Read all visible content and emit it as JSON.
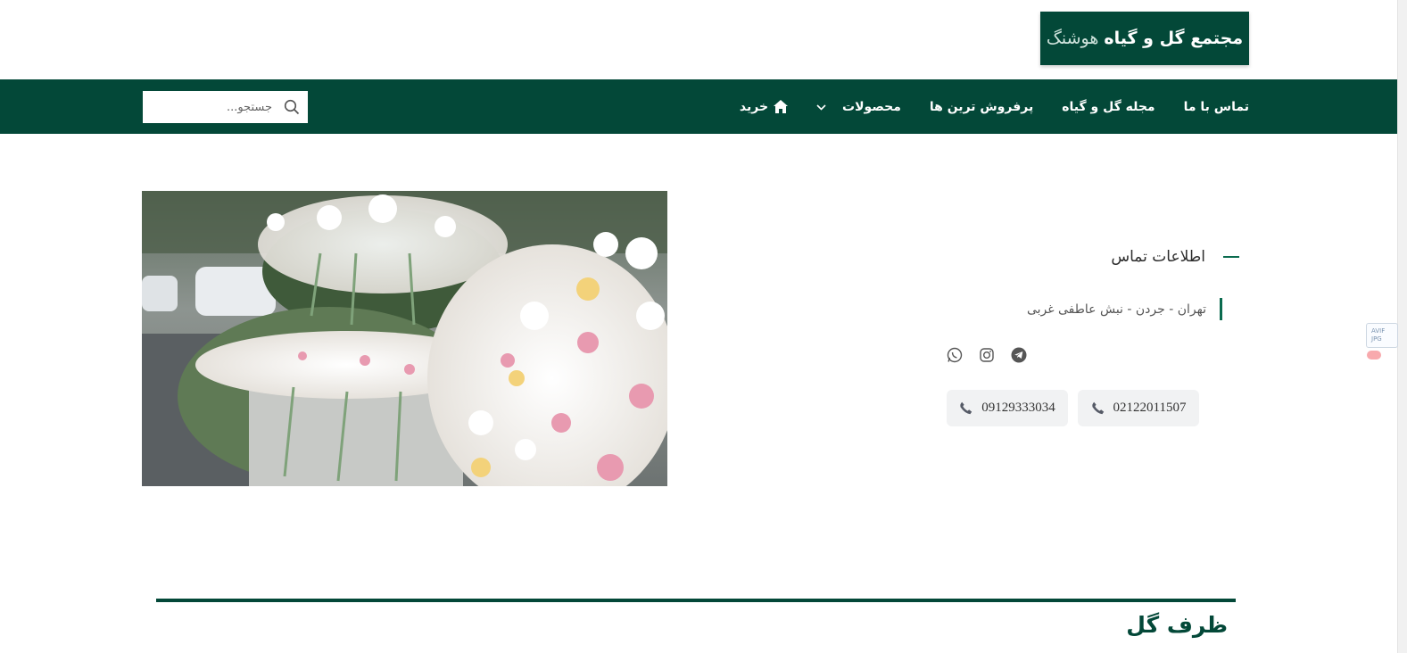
{
  "header": {
    "logo_bold": "مجتمع گل و گیاه",
    "logo_light": "هوشنگ"
  },
  "nav": {
    "items": [
      {
        "label": "خرید",
        "icon": "home-icon"
      },
      {
        "label": "محصولات",
        "icon": "chevron-down-icon"
      },
      {
        "label": "پرفروش ترین ها"
      },
      {
        "label": "مجله گل و گیاه"
      },
      {
        "label": "تماس با ما"
      }
    ],
    "search_placeholder": "جستجو..."
  },
  "contact": {
    "title": "اطلاعات تماس",
    "address": "تهران - جردن - نبش عاطفی غربی",
    "socials": [
      "whatsapp-icon",
      "instagram-icon",
      "telegram-icon"
    ],
    "phones": [
      "02122011507",
      "09129333034"
    ]
  },
  "section": {
    "title": "ظرف گل"
  },
  "extension_badge": {
    "line1": "AVIF",
    "line2": "JPG"
  },
  "colors": {
    "brand": "#034838",
    "accent": "#0b6b4f"
  }
}
